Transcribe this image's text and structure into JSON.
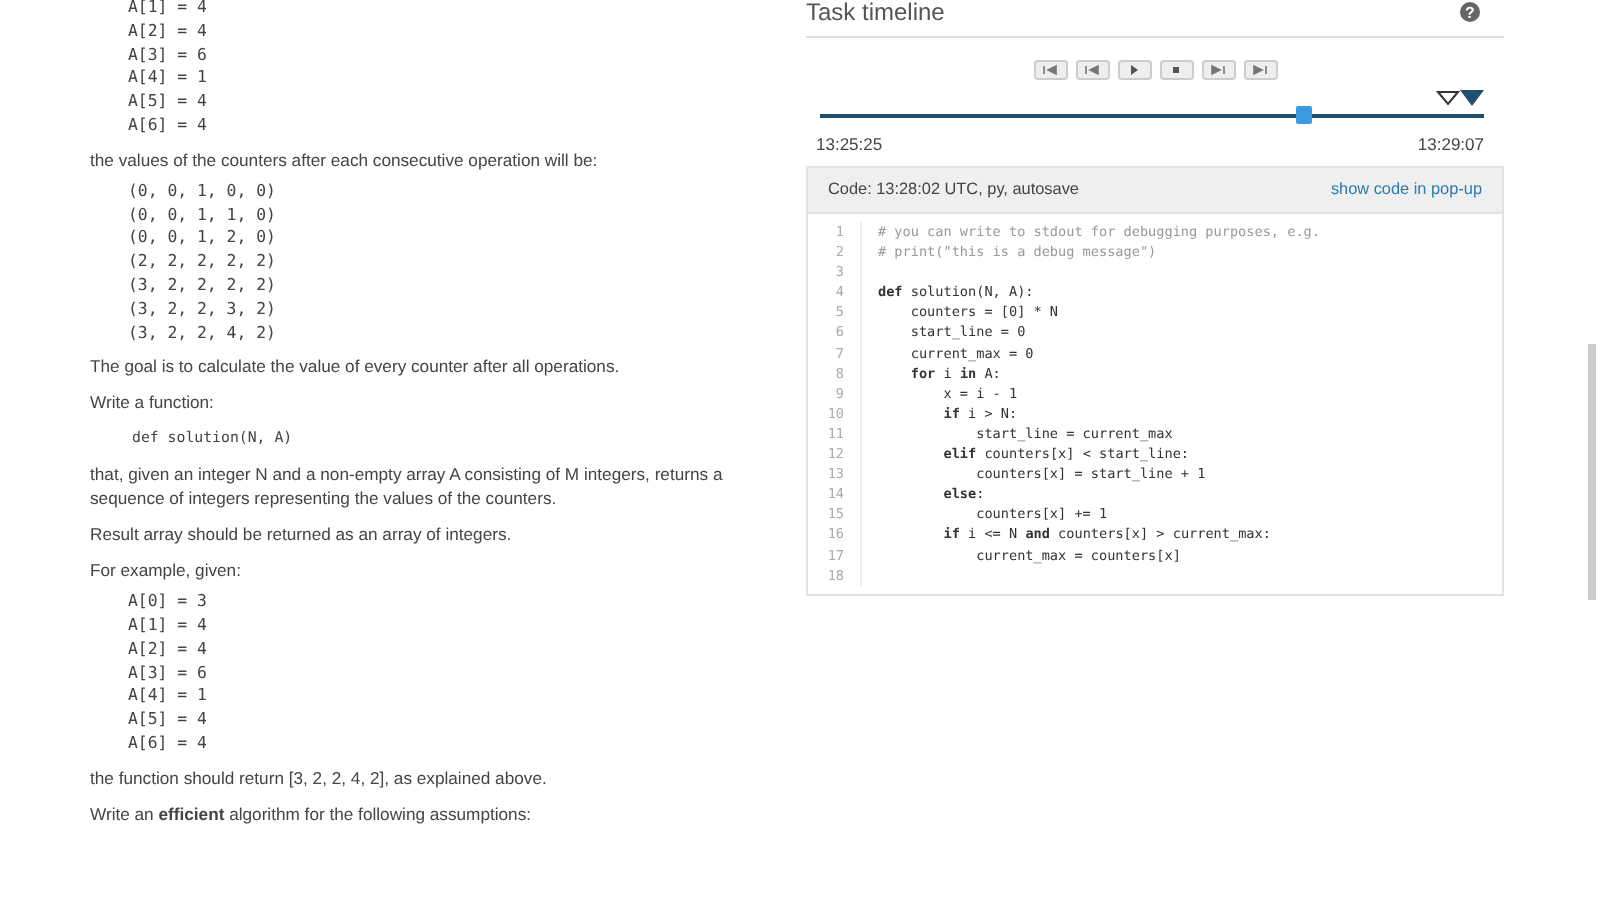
{
  "problem": {
    "blocks": [
      {
        "kind": "code",
        "lines": [
          "A[1] = 4",
          "A[2] = 4",
          "A[3] = 6",
          "A[4] = 1",
          "A[5] = 4",
          "A[6] = 4"
        ]
      },
      {
        "kind": "text",
        "text": "the values of the counters after each consecutive operation will be:"
      },
      {
        "kind": "code",
        "lines": [
          "(0, 0, 1, 0, 0)",
          "(0, 0, 1, 1, 0)",
          "(0, 0, 1, 2, 0)",
          "(2, 2, 2, 2, 2)",
          "(3, 2, 2, 2, 2)",
          "(3, 2, 2, 3, 2)",
          "(3, 2, 2, 4, 2)"
        ]
      },
      {
        "kind": "text",
        "text": "The goal is to calculate the value of every counter after all operations."
      },
      {
        "kind": "text",
        "text": "Write a function:"
      },
      {
        "kind": "signature",
        "lines": [
          "def solution(N, A)"
        ]
      },
      {
        "kind": "text",
        "text": "that, given an integer N and a non-empty array A consisting of M integers, returns a sequence of integers representing the values of the counters."
      },
      {
        "kind": "text",
        "text": "Result array should be returned as an array of integers."
      },
      {
        "kind": "text",
        "text": "For example, given:"
      },
      {
        "kind": "code",
        "lines": [
          "A[0] = 3",
          "A[1] = 4",
          "A[2] = 4",
          "A[3] = 6",
          "A[4] = 1",
          "A[5] = 4",
          "A[6] = 4"
        ]
      },
      {
        "kind": "text",
        "text": "the function should return [3, 2, 2, 4, 2], as explained above."
      },
      {
        "kind": "text",
        "text": "Write an **efficient** algorithm for the following assumptions:"
      }
    ]
  },
  "timeline": {
    "title": "Task timeline",
    "help": "?",
    "slider": {
      "level": 0.73,
      "start": "13:25:25",
      "end": "13:29:07"
    },
    "code_panel": {
      "header": "Code: 13:28:02 UTC, py, autosave",
      "link": "show code in pop-up",
      "lines": [
        {
          "n": "1",
          "kind": "comment",
          "text": "# you can write to stdout for debugging purposes, e.g."
        },
        {
          "n": "2",
          "kind": "comment",
          "text": "# print(\"this is a debug message\")"
        },
        {
          "n": "3",
          "kind": "blank"
        },
        {
          "n": "4",
          "kind": "code",
          "text": "**def** solution(N, A):"
        },
        {
          "n": "5",
          "kind": "code",
          "text": "    counters = [0] * N"
        },
        {
          "n": "6",
          "kind": "code",
          "text": "    start_line = 0"
        },
        {
          "n": "7",
          "kind": "code",
          "text": "    current_max = 0"
        },
        {
          "n": "8",
          "kind": "code",
          "text": "    **for** i **in** A:"
        },
        {
          "n": "9",
          "kind": "code",
          "text": "        x = i - 1"
        },
        {
          "n": "10",
          "kind": "code",
          "text": "        **if** i > N:"
        },
        {
          "n": "11",
          "kind": "code",
          "text": "            start_line = current_max"
        },
        {
          "n": "12",
          "kind": "code",
          "text": "        **elif** counters[x] < start_line:"
        },
        {
          "n": "13",
          "kind": "code",
          "text": "            counters[x] = start_line + 1"
        },
        {
          "n": "14",
          "kind": "code",
          "text": "        **else**:"
        },
        {
          "n": "15",
          "kind": "code",
          "text": "            counters[x] += 1"
        },
        {
          "n": "16",
          "kind": "code",
          "text": "        **if** i <= N **and** counters[x] > current_max:"
        },
        {
          "n": "17",
          "kind": "code",
          "text": "            current_max = counters[x]"
        },
        {
          "n": "18",
          "kind": "blank"
        }
      ]
    }
  }
}
